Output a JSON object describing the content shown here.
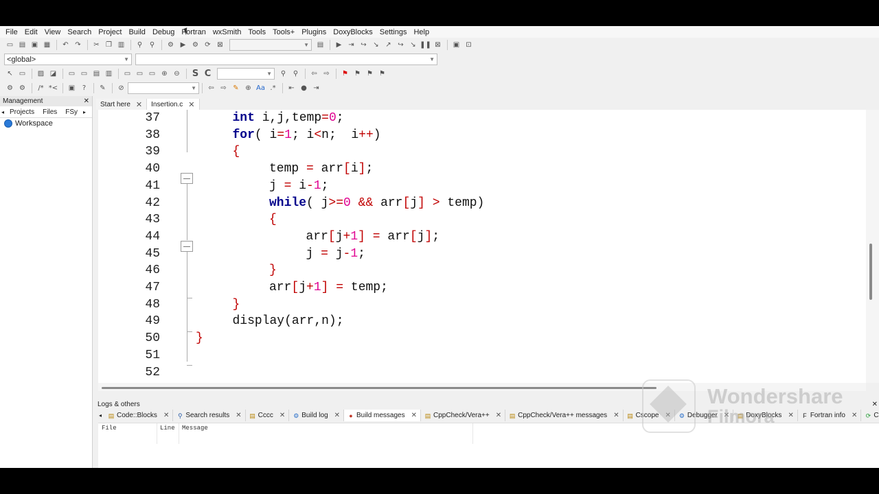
{
  "menu": [
    "File",
    "Edit",
    "View",
    "Search",
    "Project",
    "Build",
    "Debug",
    "Fortran",
    "wxSmith",
    "Tools",
    "Tools+",
    "Plugins",
    "DoxyBlocks",
    "Settings",
    "Help"
  ],
  "toolbar": {
    "scope_combo": "<global>",
    "symbol_combo": "",
    "search_combo": "",
    "target_combo": ""
  },
  "management": {
    "title": "Management",
    "tabs": [
      "Projects",
      "Files",
      "FSy"
    ],
    "workspace_label": "Workspace"
  },
  "editor_tabs": [
    {
      "label": "Start here",
      "active": false
    },
    {
      "label": "Insertion.c",
      "active": true
    }
  ],
  "code_lines": [
    {
      "n": "37",
      "tokens": [
        [
          "k",
          "int"
        ],
        [
          "t",
          " i,j,temp"
        ],
        [
          "o",
          "="
        ],
        [
          "m",
          "0"
        ],
        [
          "t",
          ";"
        ]
      ],
      "indent": 1
    },
    {
      "n": "38",
      "tokens": [
        [
          "k",
          "for"
        ],
        [
          "t",
          "( i"
        ],
        [
          "o",
          "="
        ],
        [
          "m",
          "1"
        ],
        [
          "t",
          "; i"
        ],
        [
          "o",
          "<"
        ],
        [
          "t",
          "n;  i"
        ],
        [
          "o",
          "++"
        ],
        [
          "t",
          ")"
        ]
      ],
      "indent": 1
    },
    {
      "n": "39",
      "tokens": [
        [
          "o",
          "{"
        ]
      ],
      "indent": 1
    },
    {
      "n": "40",
      "tokens": [
        [
          "t",
          "temp "
        ],
        [
          "o",
          "="
        ],
        [
          "t",
          " arr"
        ],
        [
          "o",
          "["
        ],
        [
          "t",
          "i"
        ],
        [
          "o",
          "]"
        ],
        [
          "t",
          ";"
        ]
      ],
      "indent": 2
    },
    {
      "n": "41",
      "tokens": [
        [
          "t",
          "j "
        ],
        [
          "o",
          "="
        ],
        [
          "t",
          " i"
        ],
        [
          "o",
          "-"
        ],
        [
          "m",
          "1"
        ],
        [
          "t",
          ";"
        ]
      ],
      "indent": 2
    },
    {
      "n": "42",
      "tokens": [
        [
          "k",
          "while"
        ],
        [
          "t",
          "( j"
        ],
        [
          "o",
          ">="
        ],
        [
          "m",
          "0"
        ],
        [
          "t",
          " "
        ],
        [
          "o",
          "&&"
        ],
        [
          "t",
          " arr"
        ],
        [
          "o",
          "["
        ],
        [
          "t",
          "j"
        ],
        [
          "o",
          "]"
        ],
        [
          "t",
          " "
        ],
        [
          "o",
          ">"
        ],
        [
          "t",
          " temp)"
        ]
      ],
      "indent": 2
    },
    {
      "n": "43",
      "tokens": [
        [
          "o",
          "{"
        ]
      ],
      "indent": 2
    },
    {
      "n": "44",
      "tokens": [
        [
          "t",
          "arr"
        ],
        [
          "o",
          "["
        ],
        [
          "t",
          "j"
        ],
        [
          "o",
          "+"
        ],
        [
          "m",
          "1"
        ],
        [
          "o",
          "]"
        ],
        [
          "t",
          " "
        ],
        [
          "o",
          "="
        ],
        [
          "t",
          " arr"
        ],
        [
          "o",
          "["
        ],
        [
          "t",
          "j"
        ],
        [
          "o",
          "]"
        ],
        [
          "t",
          ";"
        ]
      ],
      "indent": 3
    },
    {
      "n": "45",
      "tokens": [
        [
          "t",
          "j "
        ],
        [
          "o",
          "="
        ],
        [
          "t",
          " j"
        ],
        [
          "o",
          "-"
        ],
        [
          "m",
          "1"
        ],
        [
          "t",
          ";"
        ]
      ],
      "indent": 3
    },
    {
      "n": "46",
      "tokens": [
        [
          "o",
          "}"
        ]
      ],
      "indent": 2
    },
    {
      "n": "47",
      "tokens": [
        [
          "t",
          "arr"
        ],
        [
          "o",
          "["
        ],
        [
          "t",
          "j"
        ],
        [
          "o",
          "+"
        ],
        [
          "m",
          "1"
        ],
        [
          "o",
          "]"
        ],
        [
          "t",
          " "
        ],
        [
          "o",
          "="
        ],
        [
          "t",
          " temp;"
        ]
      ],
      "indent": 2
    },
    {
      "n": "48",
      "tokens": [
        [
          "o",
          "}"
        ]
      ],
      "indent": 1
    },
    {
      "n": "49",
      "tokens": [
        [
          "t",
          "display(arr,n);"
        ]
      ],
      "indent": 1
    },
    {
      "n": "50",
      "tokens": [
        [
          "o",
          "}"
        ]
      ],
      "indent": 0
    },
    {
      "n": "51",
      "tokens": [],
      "indent": 0
    },
    {
      "n": "52",
      "tokens": [],
      "indent": 0
    }
  ],
  "logs": {
    "title": "Logs & others",
    "tabs": [
      {
        "label": "Code::Blocks",
        "icon": "document-icon"
      },
      {
        "label": "Search results",
        "icon": "search-icon"
      },
      {
        "label": "Cccc",
        "icon": "document-icon"
      },
      {
        "label": "Build log",
        "icon": "gear-icon"
      },
      {
        "label": "Build messages",
        "icon": "pin-icon",
        "active": true
      },
      {
        "label": "CppCheck/Vera++",
        "icon": "document-icon"
      },
      {
        "label": "CppCheck/Vera++ messages",
        "icon": "document-icon"
      },
      {
        "label": "Cscope",
        "icon": "document-icon"
      },
      {
        "label": "Debugger",
        "icon": "gear-icon"
      },
      {
        "label": "DoxyBlocks",
        "icon": "document-icon"
      },
      {
        "label": "Fortran info",
        "icon": "fortran-icon"
      },
      {
        "label": "Closed",
        "icon": "closed-icon"
      }
    ],
    "columns": [
      "File",
      "Line",
      "Message"
    ]
  },
  "watermark": {
    "line1": "Wondershare",
    "line2": "Filmora"
  },
  "colors": {
    "keyword": "#00008b",
    "number": "#e00090",
    "operator": "#c00000"
  }
}
